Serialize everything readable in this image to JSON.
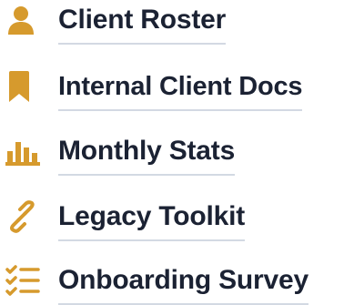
{
  "accent_color": "#d69a2d",
  "nav": {
    "items": [
      {
        "label": "Client Roster",
        "icon": "person-icon"
      },
      {
        "label": "Internal Client Docs",
        "icon": "bookmark-icon"
      },
      {
        "label": "Monthly Stats",
        "icon": "bar-chart-icon"
      },
      {
        "label": "Legacy Toolkit",
        "icon": "link-icon"
      },
      {
        "label": "Onboarding Survey",
        "icon": "checklist-icon"
      }
    ]
  }
}
